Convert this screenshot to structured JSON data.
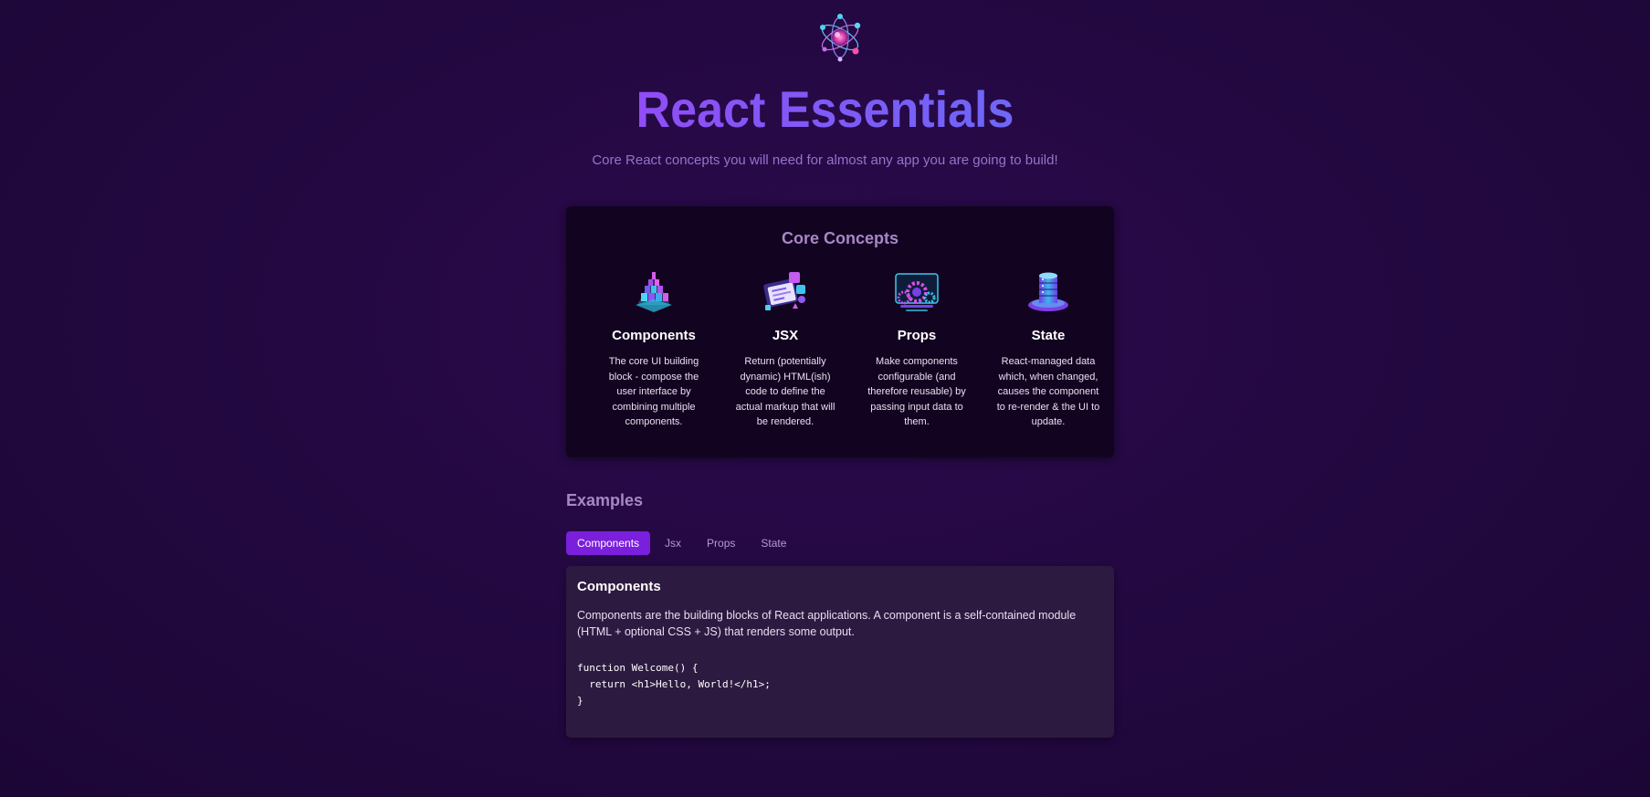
{
  "header": {
    "logo_icon": "atom-logo-icon",
    "title": "React Essentials",
    "subtitle": "Core React concepts you will need for almost any app you are going to build!"
  },
  "core_concepts": {
    "title": "Core Concepts",
    "items": [
      {
        "icon": "components-icon",
        "title": "Components",
        "description": "The core UI building block - compose the user interface by combining multiple components."
      },
      {
        "icon": "jsx-icon",
        "title": "JSX",
        "description": "Return (potentially dynamic) HTML(ish) code to define the actual markup that will be rendered."
      },
      {
        "icon": "props-icon",
        "title": "Props",
        "description": "Make components configurable (and therefore reusable) by passing input data to them."
      },
      {
        "icon": "state-icon",
        "title": "State",
        "description": "React-managed data which, when changed, causes the component to re-render & the UI to update."
      }
    ]
  },
  "examples": {
    "title": "Examples",
    "tabs": [
      {
        "label": "Components",
        "active": true
      },
      {
        "label": "Jsx",
        "active": false
      },
      {
        "label": "Props",
        "active": false
      },
      {
        "label": "State",
        "active": false
      }
    ],
    "panel": {
      "title": "Components",
      "description": "Components are the building blocks of React applications. A component is a self-contained module (HTML + optional CSS + JS) that renders some output.",
      "code": "function Welcome() {\n  return <h1>Hello, World!</h1>;\n}"
    }
  },
  "colors": {
    "background": "#22083f",
    "card": "#120420",
    "panel": "#2d1a40",
    "accent": "#7a1fdc",
    "heading_muted": "#a787c6"
  }
}
